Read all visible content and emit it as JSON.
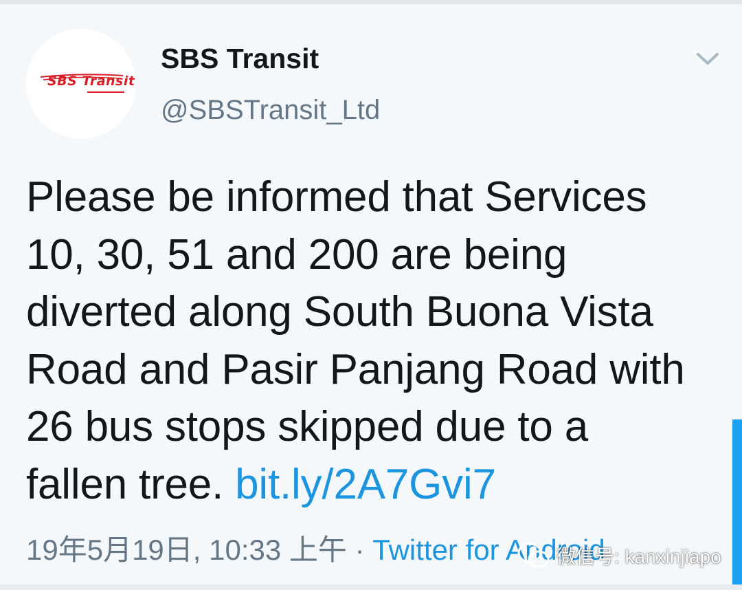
{
  "tweet": {
    "author": {
      "display_name": "SBS Transit",
      "handle": "@SBSTransit_Ltd",
      "avatar_logo_text": "SBS Transit"
    },
    "text_lines": [
      "Please be informed that Services",
      "10, 30, 51 and 200 are being",
      "diverted along South Buona Vista",
      "Road and Pasir Panjang Road with",
      "26 bus stops skipped due to a"
    ],
    "last_line_text": "fallen tree. ",
    "link_text": "bit.ly/2A7Gvi7",
    "timestamp": "19年5月19日, 10:33 上午",
    "separator": " · ",
    "source": "Twitter for Android",
    "menu_icon": "chevron-down-icon"
  },
  "watermark": {
    "text": "微信号: kanxinjiapo",
    "icon": "wechat-icon"
  },
  "colors": {
    "background": "#f5f8fa",
    "text": "#14171a",
    "secondary": "#657786",
    "link": "#1b95e0",
    "brand_red": "#d61f26"
  }
}
